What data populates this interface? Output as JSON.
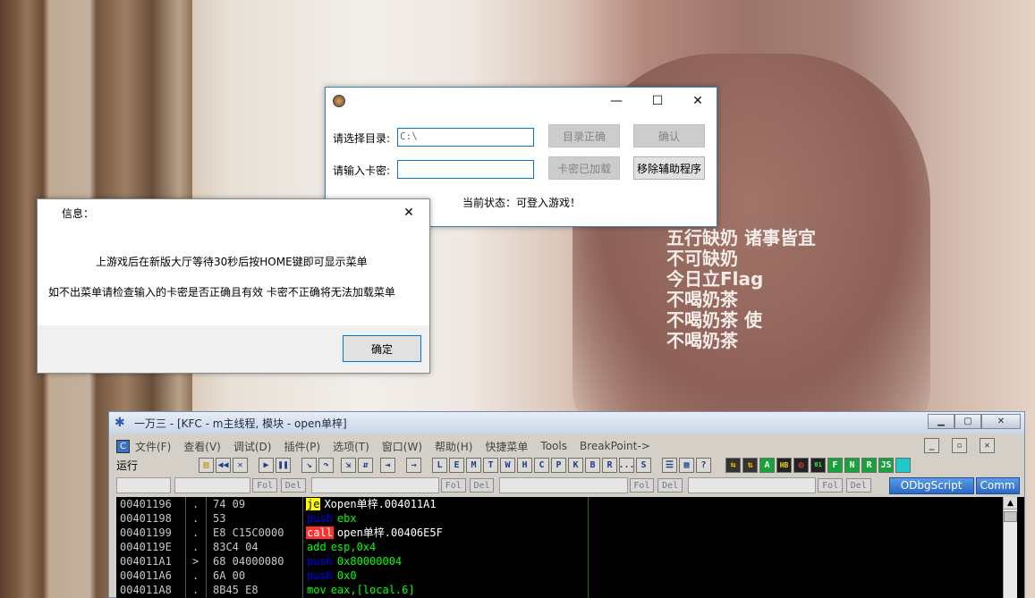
{
  "dialog_main": {
    "dir_label": "请选择目录:",
    "dir_value": "C:\\",
    "dir_ok_btn": "目录正确",
    "confirm_btn": "确认",
    "key_label": "请输入卡密:",
    "key_value": "",
    "key_loaded_btn": "卡密已加载",
    "remove_btn": "移除辅助程序",
    "status": "当前状态：可登入游戏！",
    "min_glyph": "—",
    "max_glyph": "☐",
    "close_glyph": "✕"
  },
  "info_dialog": {
    "title": "信息：",
    "line1": "上游戏后在新版大厅等待30秒后按HOME键即可显示菜单",
    "line2": "如不出菜单请检查输入的卡密是否正确且有效 卡密不正确将无法加载菜单",
    "ok_btn": "确定",
    "close_glyph": "✕"
  },
  "olly": {
    "title": "一万三 - [KFC - m主线程, 模块 - open单梓]",
    "menu": [
      "文件(F)",
      "查看(V)",
      "调试(D)",
      "插件(P)",
      "选项(T)",
      "窗口(W)",
      "帮助(H)",
      "快捷菜单",
      "Tools",
      "BreakPoint->"
    ],
    "status": "运行",
    "letter_buttons": [
      "L",
      "E",
      "M",
      "T",
      "W",
      "H",
      "C",
      "P",
      "K",
      "B",
      "R",
      "...",
      "S"
    ],
    "right_buttons": [
      "A",
      "HB",
      "F",
      "N",
      "R",
      "JS"
    ],
    "fol": "Fol",
    "del": "Del",
    "odbgscript": "ODbgScript",
    "comm": "Comm",
    "rows": [
      {
        "addr": "00401196",
        "mark": ".",
        "hex": "74 09",
        "op": "je",
        "arg": "Xopen单梓.004011A1",
        "opcolor": "#000000",
        "opbg": "#ffff00",
        "argcolor": "#ffffff"
      },
      {
        "addr": "00401198",
        "mark": ".",
        "hex": "53",
        "op": "push",
        "arg": "ebx",
        "opcolor": "#0000ff",
        "opbg": "",
        "argcolor": "#00ff00"
      },
      {
        "addr": "00401199",
        "mark": ".",
        "hex": "E8 C15C0000",
        "op": "call",
        "arg": "open单梓.00406E5F",
        "opcolor": "#ffffff",
        "opbg": "#ff3030",
        "argcolor": "#ffffff"
      },
      {
        "addr": "0040119E",
        "mark": ".",
        "hex": "83C4 04",
        "op": "add",
        "arg": "esp,0x4",
        "opcolor": "#00ff00",
        "opbg": "",
        "argcolor": "#00ff00"
      },
      {
        "addr": "004011A1",
        "mark": ">",
        "hex": "68 04000080",
        "op": "push",
        "arg": "0x80000004",
        "opcolor": "#0000ff",
        "opbg": "",
        "argcolor": "#00ff00"
      },
      {
        "addr": "004011A6",
        "mark": ".",
        "hex": "6A 00",
        "op": "push",
        "arg": "0x0",
        "opcolor": "#0000ff",
        "opbg": "",
        "argcolor": "#00ff00"
      },
      {
        "addr": "004011A8",
        "mark": ".",
        "hex": "8B45 E8",
        "op": "mov",
        "arg": "eax,[local.6]",
        "opcolor": "#00ff00",
        "opbg": "",
        "argcolor": "#00ff00"
      }
    ]
  },
  "background_text": [
    "五行缺奶 诸事皆宜",
    "不可缺奶",
    "今日立Flag",
    "不喝奶茶",
    "不喝奶茶 使",
    "不喝奶茶"
  ]
}
